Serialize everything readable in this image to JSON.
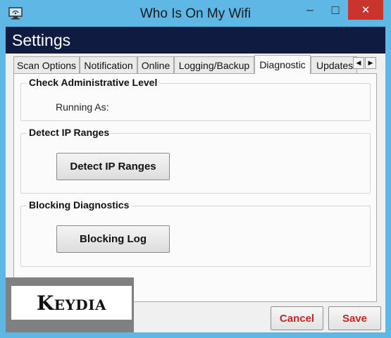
{
  "window": {
    "title": "Who Is On My Wifi",
    "controls": {
      "minimize": "─",
      "maximize": "□",
      "close": "✕"
    }
  },
  "header": {
    "title": "Settings"
  },
  "tabs": [
    {
      "label": "Scan Options",
      "active": false
    },
    {
      "label": "Notification",
      "active": false
    },
    {
      "label": "Online",
      "active": false
    },
    {
      "label": "Logging/Backup",
      "active": false
    },
    {
      "label": "Diagnostic",
      "active": true
    },
    {
      "label": "Updates",
      "active": false
    }
  ],
  "tab_scroll": {
    "left": "◀",
    "right": "▶"
  },
  "groups": {
    "admin": {
      "title": "Check Administrative Level",
      "running_as_label": "Running As:"
    },
    "ip": {
      "title": "Detect IP Ranges",
      "button": "Detect IP Ranges"
    },
    "blocking": {
      "title": "Blocking Diagnostics",
      "button": "Blocking Log"
    }
  },
  "footer": {
    "cancel": "Cancel",
    "save": "Save"
  },
  "watermark": {
    "text": "Keydia"
  },
  "colors": {
    "titlebar": "#5fb7e6",
    "header": "#0f1b40",
    "close_button": "#c9342d",
    "footer_text": "#c22525"
  }
}
